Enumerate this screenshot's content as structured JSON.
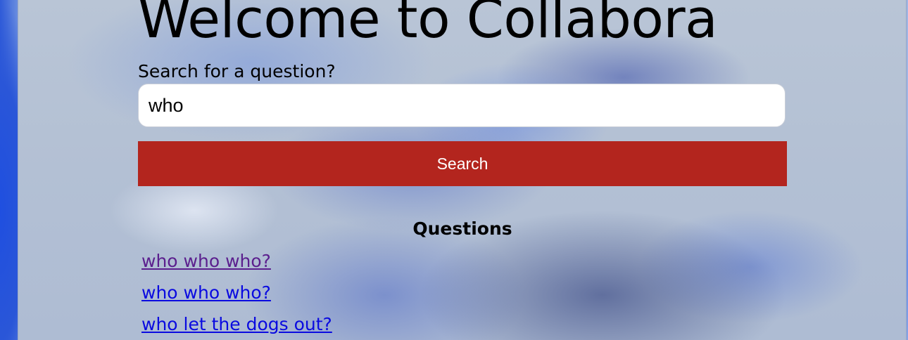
{
  "page": {
    "title": "Welcome to Collabora"
  },
  "search": {
    "label": "Search for a question?",
    "value": "who",
    "button_label": "Search"
  },
  "questions": {
    "heading": "Questions",
    "items": [
      {
        "text": "who who who?",
        "visited": true
      },
      {
        "text": "who who who?",
        "visited": false
      },
      {
        "text": "who let the dogs out?",
        "visited": false
      }
    ]
  },
  "colors": {
    "button": "#b3251e",
    "link": "#0a0ae0",
    "visited_link": "#5b1f8e"
  }
}
